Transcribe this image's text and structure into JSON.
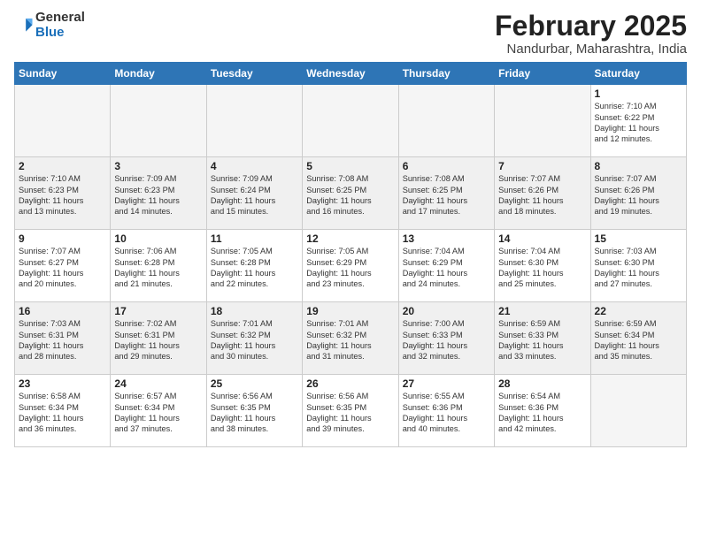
{
  "header": {
    "logo_general": "General",
    "logo_blue": "Blue",
    "month_year": "February 2025",
    "location": "Nandurbar, Maharashtra, India"
  },
  "days_of_week": [
    "Sunday",
    "Monday",
    "Tuesday",
    "Wednesday",
    "Thursday",
    "Friday",
    "Saturday"
  ],
  "weeks": [
    {
      "shade": false,
      "days": [
        {
          "num": "",
          "info": ""
        },
        {
          "num": "",
          "info": ""
        },
        {
          "num": "",
          "info": ""
        },
        {
          "num": "",
          "info": ""
        },
        {
          "num": "",
          "info": ""
        },
        {
          "num": "",
          "info": ""
        },
        {
          "num": "1",
          "info": "Sunrise: 7:10 AM\nSunset: 6:22 PM\nDaylight: 11 hours\nand 12 minutes."
        }
      ]
    },
    {
      "shade": true,
      "days": [
        {
          "num": "2",
          "info": "Sunrise: 7:10 AM\nSunset: 6:23 PM\nDaylight: 11 hours\nand 13 minutes."
        },
        {
          "num": "3",
          "info": "Sunrise: 7:09 AM\nSunset: 6:23 PM\nDaylight: 11 hours\nand 14 minutes."
        },
        {
          "num": "4",
          "info": "Sunrise: 7:09 AM\nSunset: 6:24 PM\nDaylight: 11 hours\nand 15 minutes."
        },
        {
          "num": "5",
          "info": "Sunrise: 7:08 AM\nSunset: 6:25 PM\nDaylight: 11 hours\nand 16 minutes."
        },
        {
          "num": "6",
          "info": "Sunrise: 7:08 AM\nSunset: 6:25 PM\nDaylight: 11 hours\nand 17 minutes."
        },
        {
          "num": "7",
          "info": "Sunrise: 7:07 AM\nSunset: 6:26 PM\nDaylight: 11 hours\nand 18 minutes."
        },
        {
          "num": "8",
          "info": "Sunrise: 7:07 AM\nSunset: 6:26 PM\nDaylight: 11 hours\nand 19 minutes."
        }
      ]
    },
    {
      "shade": false,
      "days": [
        {
          "num": "9",
          "info": "Sunrise: 7:07 AM\nSunset: 6:27 PM\nDaylight: 11 hours\nand 20 minutes."
        },
        {
          "num": "10",
          "info": "Sunrise: 7:06 AM\nSunset: 6:28 PM\nDaylight: 11 hours\nand 21 minutes."
        },
        {
          "num": "11",
          "info": "Sunrise: 7:05 AM\nSunset: 6:28 PM\nDaylight: 11 hours\nand 22 minutes."
        },
        {
          "num": "12",
          "info": "Sunrise: 7:05 AM\nSunset: 6:29 PM\nDaylight: 11 hours\nand 23 minutes."
        },
        {
          "num": "13",
          "info": "Sunrise: 7:04 AM\nSunset: 6:29 PM\nDaylight: 11 hours\nand 24 minutes."
        },
        {
          "num": "14",
          "info": "Sunrise: 7:04 AM\nSunset: 6:30 PM\nDaylight: 11 hours\nand 25 minutes."
        },
        {
          "num": "15",
          "info": "Sunrise: 7:03 AM\nSunset: 6:30 PM\nDaylight: 11 hours\nand 27 minutes."
        }
      ]
    },
    {
      "shade": true,
      "days": [
        {
          "num": "16",
          "info": "Sunrise: 7:03 AM\nSunset: 6:31 PM\nDaylight: 11 hours\nand 28 minutes."
        },
        {
          "num": "17",
          "info": "Sunrise: 7:02 AM\nSunset: 6:31 PM\nDaylight: 11 hours\nand 29 minutes."
        },
        {
          "num": "18",
          "info": "Sunrise: 7:01 AM\nSunset: 6:32 PM\nDaylight: 11 hours\nand 30 minutes."
        },
        {
          "num": "19",
          "info": "Sunrise: 7:01 AM\nSunset: 6:32 PM\nDaylight: 11 hours\nand 31 minutes."
        },
        {
          "num": "20",
          "info": "Sunrise: 7:00 AM\nSunset: 6:33 PM\nDaylight: 11 hours\nand 32 minutes."
        },
        {
          "num": "21",
          "info": "Sunrise: 6:59 AM\nSunset: 6:33 PM\nDaylight: 11 hours\nand 33 minutes."
        },
        {
          "num": "22",
          "info": "Sunrise: 6:59 AM\nSunset: 6:34 PM\nDaylight: 11 hours\nand 35 minutes."
        }
      ]
    },
    {
      "shade": false,
      "days": [
        {
          "num": "23",
          "info": "Sunrise: 6:58 AM\nSunset: 6:34 PM\nDaylight: 11 hours\nand 36 minutes."
        },
        {
          "num": "24",
          "info": "Sunrise: 6:57 AM\nSunset: 6:34 PM\nDaylight: 11 hours\nand 37 minutes."
        },
        {
          "num": "25",
          "info": "Sunrise: 6:56 AM\nSunset: 6:35 PM\nDaylight: 11 hours\nand 38 minutes."
        },
        {
          "num": "26",
          "info": "Sunrise: 6:56 AM\nSunset: 6:35 PM\nDaylight: 11 hours\nand 39 minutes."
        },
        {
          "num": "27",
          "info": "Sunrise: 6:55 AM\nSunset: 6:36 PM\nDaylight: 11 hours\nand 40 minutes."
        },
        {
          "num": "28",
          "info": "Sunrise: 6:54 AM\nSunset: 6:36 PM\nDaylight: 11 hours\nand 42 minutes."
        },
        {
          "num": "",
          "info": ""
        }
      ]
    }
  ]
}
